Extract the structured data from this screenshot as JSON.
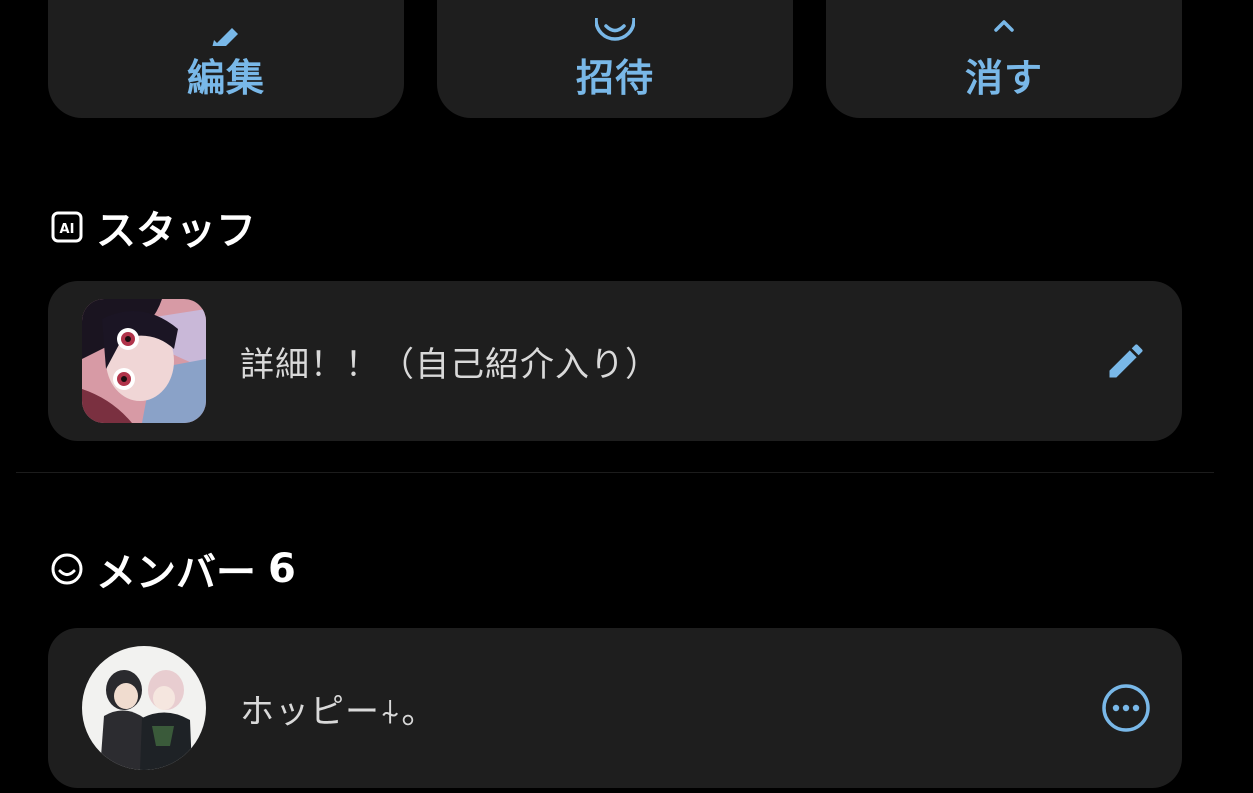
{
  "colors": {
    "background": "#000000",
    "card": "#1e1e1e",
    "accent": "#79b8e8",
    "text": "#ffffff",
    "subtext": "#d9d9d9"
  },
  "actions": [
    {
      "label": "編集",
      "icon": "pencil-icon"
    },
    {
      "label": "招待",
      "icon": "smiley-icon"
    },
    {
      "label": "消す",
      "icon": "chevron-up-icon"
    }
  ],
  "staff": {
    "title": "スタッフ",
    "icon": "ai-badge-icon",
    "card": {
      "name": "詳細！！（自己紹介入り）",
      "avatar": "anime-character-avatar",
      "action_icon": "edit-pencil-icon"
    }
  },
  "members": {
    "title": "メンバー",
    "count": "6",
    "icon": "smiley-icon",
    "items": [
      {
        "name": "ホッピー⍭。",
        "avatar": "two-characters-avatar",
        "action_icon": "more-options-icon"
      }
    ]
  }
}
